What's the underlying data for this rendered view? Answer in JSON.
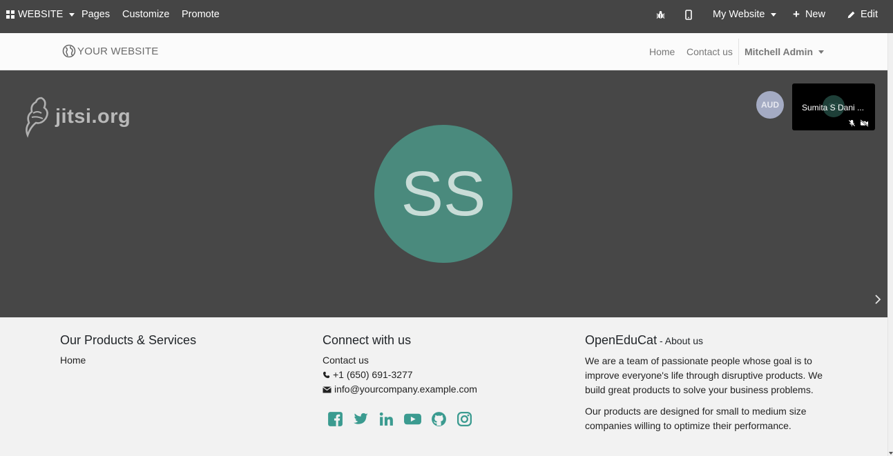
{
  "adminbar": {
    "app_menu": "WEBSITE",
    "pages": "Pages",
    "customize": "Customize",
    "promote": "Promote",
    "website_selector": "My Website",
    "new": "New",
    "edit": "Edit"
  },
  "header": {
    "logo": "YOUR WEBSITE",
    "nav": [
      "Home",
      "Contact us"
    ],
    "user": "Mitchell Admin"
  },
  "jitsi": {
    "logo_text": "jitsi.org",
    "main_avatar_initials": "SS",
    "audio_only_badge": "AUD",
    "thumbnail_initials": "SS",
    "thumbnail_name": "Sumita S Dani ..."
  },
  "footer": {
    "products": {
      "title": "Our Products & Services",
      "links": [
        "Home"
      ]
    },
    "connect": {
      "title": "Connect with us",
      "contact": "Contact us",
      "phone": "+1 (650) 691-3277",
      "email": "info@yourcompany.example.com",
      "social": [
        "facebook-icon",
        "twitter-icon",
        "linkedin-icon",
        "youtube-icon",
        "github-icon",
        "instagram-icon"
      ]
    },
    "about": {
      "brand": "OpenEduCat",
      "suffix": " - About us",
      "para1": "We are a team of passionate people whose goal is to improve everyone's life through disruptive products. We build great products to solve your business problems.",
      "para2": "Our products are designed for small to medium size companies willing to optimize their performance."
    }
  },
  "colors": {
    "admin_bar": "#454545",
    "accent": "#3b9b90",
    "jitsi_bg": "#474747",
    "avatar": "#4a8a7d"
  }
}
